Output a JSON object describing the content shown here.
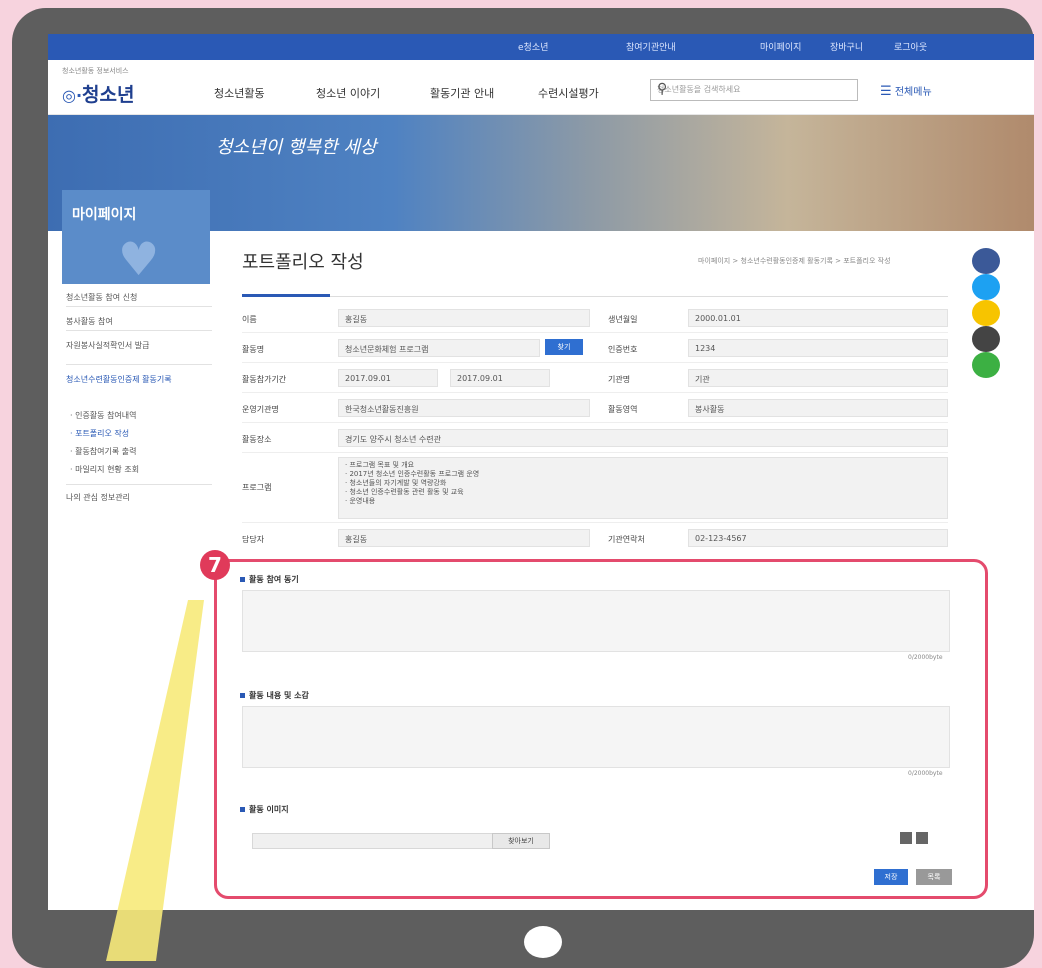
{
  "topbar": {
    "items": [
      "e청소년",
      "참여기관안내",
      "마이페이지",
      "장바구니",
      "로그아웃"
    ]
  },
  "header": {
    "logo_small": "청소년활동 정보서비스",
    "logo": "청소년",
    "nav": [
      "청소년활동",
      "청소년 이야기",
      "활동기관 안내",
      "수련시설평가"
    ],
    "search_placeholder": "청소년활동을 검색하세요",
    "menu_label": "전체메뉴"
  },
  "banner": {
    "script": "청소년이 행복한 세상"
  },
  "sidebar": {
    "mypage_title": "마이페이지",
    "items": [
      "청소년활동 참여 신청",
      "봉사활동 참여",
      "자원봉사실적확인서 발급",
      "청소년수련활동인증제 활동기록",
      "· 인증활동 참여내역",
      "· 포트폴리오 작성",
      "· 활동참여기록 출력",
      "· 마일리지 현황 조회",
      "나의 관심 정보관리"
    ]
  },
  "main": {
    "title": "포트폴리오 작성",
    "breadcrumb": "마이페이지 > 청소년수련활동인증제 활동기록 > 포트폴리오 작성"
  },
  "form": {
    "rows": [
      {
        "label1": "이름",
        "value1": "홍길동",
        "label2": "생년월일",
        "value2": "2000.01.01"
      },
      {
        "label1": "활동명",
        "value1": "청소년문화체험 프로그램",
        "find": "찾기",
        "label2": "인증번호",
        "value2": "1234"
      },
      {
        "label1": "활동참가기간",
        "value1": "2017.09.01",
        "value1b": "2017.09.01",
        "label2": "기관명",
        "value2": "기관"
      },
      {
        "label1": "운영기관명",
        "value1": "한국청소년활동진흥원",
        "label2": "활동영역",
        "value2": "봉사활동"
      },
      {
        "label1": "활동장소",
        "value1": "경기도 양주시 청소년 수련관"
      }
    ],
    "content_label": "프로그램",
    "content_lines": [
      "· 프로그램 목표 및 개요",
      "· 2017년 청소년 인증수련활동 프로그램 운영",
      "· 청소년들의 자기계발 및 역량강화",
      "· 청소년 인증수련활동 관련 활동 및 교육",
      "· 운영내용"
    ],
    "last_row": {
      "label1": "담당자",
      "value1": "홍길동",
      "label2": "기관연락처",
      "value2": "02-123-4567"
    }
  },
  "annotation_number": "7",
  "section1": {
    "label": "활동 참여 동기",
    "counter": "0/2000byte"
  },
  "section2": {
    "label": "활동 내용 및 소감",
    "counter": "0/2000byte"
  },
  "section3": {
    "label": "활동 이미지",
    "file_button": "찾아보기"
  },
  "buttons": {
    "save": "저장",
    "list": "목록"
  },
  "colors": {
    "primary": "#2a59b5",
    "annotation": "#e44b6d",
    "background": "#f7d3de"
  },
  "social": [
    {
      "name": "facebook-icon",
      "color": "#3b5998"
    },
    {
      "name": "twitter-icon",
      "color": "#1da1f2"
    },
    {
      "name": "kakaostory-icon",
      "color": "#f7c400"
    },
    {
      "name": "band-icon",
      "color": "#444444"
    },
    {
      "name": "link-icon",
      "color": "#3cb043"
    }
  ]
}
